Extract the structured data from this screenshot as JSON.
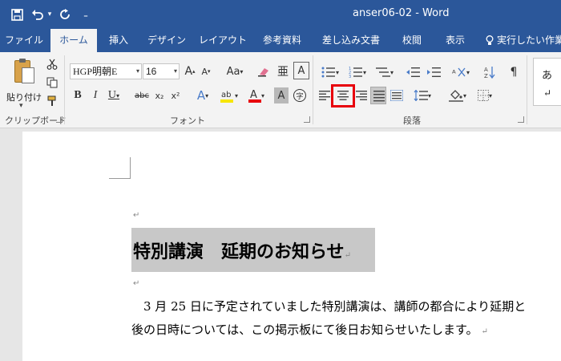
{
  "window": {
    "title": "anser06-02  -  Word"
  },
  "quick_access": {
    "save_icon": "save-icon",
    "undo_icon": "undo-icon",
    "redo_icon": "redo-icon",
    "customize_icon": "customize-icon"
  },
  "tabs": [
    {
      "label": "ファイル"
    },
    {
      "label": "ホーム"
    },
    {
      "label": "挿入"
    },
    {
      "label": "デザイン"
    },
    {
      "label": "レイアウト"
    },
    {
      "label": "参考資料"
    },
    {
      "label": "差し込み文書"
    },
    {
      "label": "校閲"
    },
    {
      "label": "表示"
    }
  ],
  "tell_me": {
    "placeholder": "実行したい作業"
  },
  "ribbon": {
    "clipboard": {
      "paste_label": "貼り付け",
      "group_label": "クリップボード"
    },
    "font": {
      "font_name": "HGP明朝E",
      "font_size": "16",
      "group_label": "フォント",
      "bold": "B",
      "italic": "I",
      "underline": "U",
      "strike": "abc",
      "subscript": "x₂",
      "superscript": "x²",
      "case": "Aa",
      "grow": "A",
      "shrink": "A",
      "font_color": "A",
      "text_effect": "A",
      "char_shading": "A",
      "enclose": "字"
    },
    "paragraph": {
      "group_label": "段落"
    },
    "styles": {
      "preview": "あ"
    }
  },
  "document": {
    "headline": "特別講演　延期のお知らせ",
    "body_line1": "　3 月 25 日に予定されていました特別講演は、講師の都合により延期と",
    "body_line2": "後の日時については、この掲示板にて後日お知らせいたします。",
    "para_mark": "↵",
    "head_mark": "↵"
  },
  "colors": {
    "title_bar": "#2b579a",
    "highlight": "#e8000b",
    "font_red": "#e8000b",
    "marker_yellow": "#f7e600"
  }
}
